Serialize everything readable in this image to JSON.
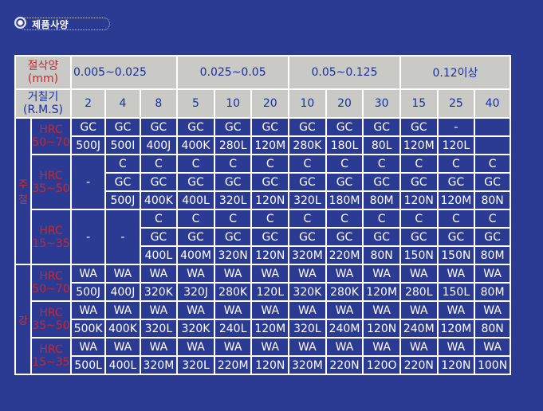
{
  "title": "제품사양",
  "header": {
    "cut_label_1": "절삭양",
    "cut_label_2": "(mm)",
    "ranges": [
      "0.005~0.025",
      "0.025~0.05",
      "0.05~0.125",
      "0.12이상"
    ],
    "rough_label_1": "거칠기",
    "rough_label_2": "(R.M.S)",
    "roughness": [
      "2",
      "4",
      "8",
      "5",
      "10",
      "20",
      "10",
      "20",
      "30",
      "15",
      "25",
      "40"
    ]
  },
  "groups": [
    {
      "label": "주철",
      "subs": [
        {
          "label_1": "HRC",
          "label_2": "50~70",
          "rows": [
            [
              "GC",
              "GC",
              "GC",
              "GC",
              "GC",
              "GC",
              "GC",
              "GC",
              "GC",
              "GC",
              "-",
              ""
            ],
            [
              "500J",
              "500I",
              "400J",
              "400K",
              "280L",
              "120M",
              "280K",
              "180L",
              "80L",
              "120M",
              "120L",
              ""
            ]
          ]
        },
        {
          "label_1": "HRC",
          "label_2": "35~50",
          "dash": [
            "-"
          ],
          "rows": [
            [
              "C",
              "C",
              "C",
              "C",
              "C",
              "C",
              "C",
              "C",
              "C",
              "C",
              "C"
            ],
            [
              "GC",
              "GC",
              "GC",
              "GC",
              "GC",
              "GC",
              "GC",
              "GC",
              "GC",
              "GC",
              "GC"
            ],
            [
              "500J",
              "400K",
              "400L",
              "320L",
              "120N",
              "320L",
              "180M",
              "80M",
              "120N",
              "120M",
              "80N"
            ]
          ]
        },
        {
          "label_1": "HRC",
          "label_2": "15~35",
          "dash": [
            "-",
            "-"
          ],
          "rows": [
            [
              "C",
              "C",
              "C",
              "C",
              "C",
              "C",
              "C",
              "C",
              "C",
              "C"
            ],
            [
              "GC",
              "GC",
              "GC",
              "GC",
              "GC",
              "GC",
              "GC",
              "GC",
              "GC",
              "GC"
            ],
            [
              "400L",
              "400M",
              "320N",
              "120N",
              "320M",
              "220M",
              "80N",
              "150N",
              "150N",
              "80M"
            ]
          ]
        }
      ]
    },
    {
      "label": "강",
      "subs": [
        {
          "label_1": "HRC",
          "label_2": "50~70",
          "rows": [
            [
              "WA",
              "WA",
              "WA",
              "WA",
              "WA",
              "WA",
              "WA",
              "WA",
              "WA",
              "WA",
              "WA",
              "WA"
            ],
            [
              "500J",
              "400J",
              "320K",
              "320J",
              "280K",
              "120L",
              "320K",
              "280K",
              "120M",
              "280L",
              "150L",
              "80M"
            ]
          ]
        },
        {
          "label_1": "HRC",
          "label_2": "35~50",
          "rows": [
            [
              "WA",
              "WA",
              "WA",
              "WA",
              "WA",
              "WA",
              "WA",
              "WA",
              "WA",
              "WA",
              "WA",
              "WA"
            ],
            [
              "500K",
              "400K",
              "320L",
              "320K",
              "240L",
              "120M",
              "320L",
              "240M",
              "120N",
              "240M",
              "120M",
              "80N"
            ]
          ]
        },
        {
          "label_1": "HRC",
          "label_2": "15~35",
          "rows": [
            [
              "WA",
              "WA",
              "WA",
              "WA",
              "WA",
              "WA",
              "WA",
              "WA",
              "WA",
              "WA",
              "WA",
              "WA"
            ],
            [
              "500L",
              "400L",
              "320M",
              "320L",
              "220M",
              "120N",
              "320M",
              "220N",
              "120O",
              "220N",
              "120N",
              "100N"
            ]
          ]
        }
      ]
    }
  ]
}
